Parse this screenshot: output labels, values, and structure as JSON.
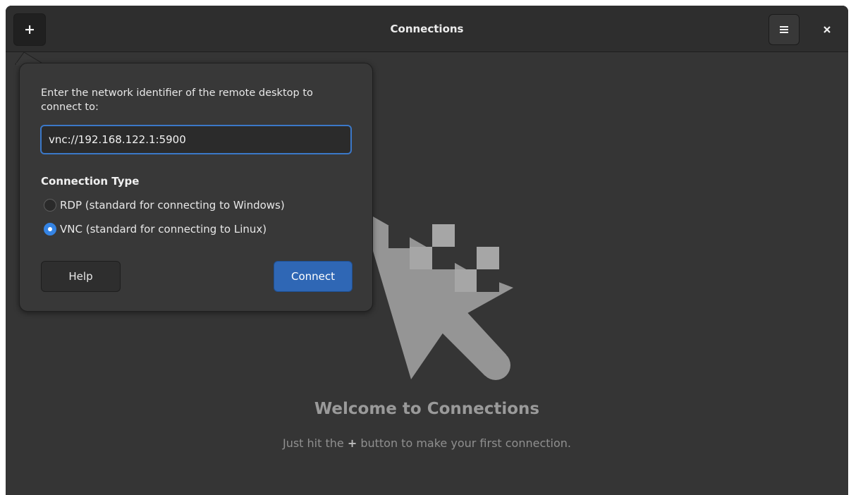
{
  "window": {
    "title": "Connections"
  },
  "headerbar": {
    "add_icon": "plus-icon",
    "menu_icon": "hamburger-menu-icon",
    "close_icon": "close-icon"
  },
  "popover": {
    "description": "Enter the network identifier of the remote desktop to connect to:",
    "address_value": "vnc://192.168.122.1:5900",
    "section_title": "Connection Type",
    "options": [
      {
        "label": "RDP (standard for connecting to Windows)",
        "selected": false
      },
      {
        "label": "VNC (standard for connecting to Linux)",
        "selected": true
      }
    ],
    "help_label": "Help",
    "connect_label": "Connect"
  },
  "empty_state": {
    "title": "Welcome to Connections",
    "subtitle_before": "Just hit the ",
    "subtitle_symbol": "+",
    "subtitle_after": " button to make your first connection.",
    "illustration_icon": "pointer-cursor-icon"
  },
  "colors": {
    "window_bg": "#353535",
    "headerbar_bg": "#2e2e2e",
    "accent": "#3584e4",
    "connect_button": "#2f67b5"
  }
}
